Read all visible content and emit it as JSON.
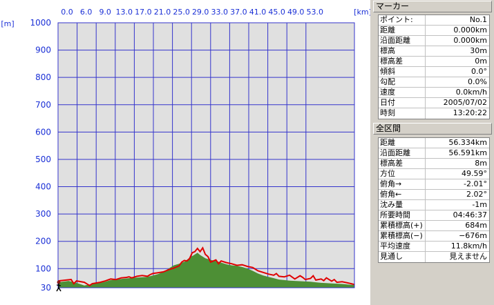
{
  "chart_data": {
    "type": "area",
    "x_unit": "[km]",
    "y_unit": "[m]",
    "x_tick_labels": [
      "0.0",
      "6.0",
      "9.0",
      "13.0",
      "17.0",
      "21.0",
      "25.0",
      "29.0",
      "33.0",
      "37.0",
      "41.0",
      "45.0",
      "49.0",
      "53.0"
    ],
    "y_tick_labels": [
      "1000",
      "900",
      "800",
      "700",
      "600",
      "500",
      "400",
      "300",
      "200",
      "100",
      "30"
    ],
    "xlim": [
      0,
      56.334
    ],
    "ylim": [
      30,
      1000
    ],
    "grid": true,
    "series": [
      {
        "x": [
          0,
          2,
          3.5,
          5,
          6,
          6.5,
          8,
          9,
          10,
          12,
          13,
          14,
          15.5,
          17,
          18,
          19,
          20,
          21,
          22,
          23,
          24,
          25,
          26,
          26.5,
          27,
          28,
          29,
          30,
          31,
          32,
          33,
          34,
          35,
          36,
          37,
          38,
          39,
          40,
          41,
          42,
          43,
          44,
          45,
          46,
          47,
          48,
          49,
          50,
          51,
          52,
          53,
          54,
          55,
          56.3
        ],
        "values": [
          50,
          55,
          48,
          38,
          42,
          45,
          48,
          52,
          58,
          62,
          64,
          66,
          68,
          70,
          75,
          80,
          88,
          100,
          112,
          118,
          125,
          140,
          152,
          158,
          150,
          138,
          132,
          128,
          122,
          116,
          112,
          110,
          106,
          100,
          92,
          82,
          75,
          70,
          65,
          60,
          58,
          56,
          55,
          54,
          53,
          52,
          50,
          48,
          47,
          46,
          45,
          44,
          42,
          40
        ]
      },
      {
        "x": [
          0,
          1.5,
          2.5,
          3,
          3.5,
          5,
          6,
          6.5,
          8,
          9,
          10,
          11,
          12,
          13,
          13.5,
          14,
          15,
          16,
          17,
          17.5,
          18,
          19,
          20,
          20.5,
          21,
          22,
          23,
          23.5,
          24,
          24.5,
          25,
          25.5,
          26,
          26.5,
          27,
          27.5,
          28,
          28.5,
          29,
          30,
          30.5,
          31,
          32,
          33,
          34,
          35,
          36,
          37,
          37.5,
          38,
          39,
          40,
          41,
          41.5,
          42,
          43,
          44,
          45,
          46,
          46.5,
          47,
          48,
          48.5,
          49,
          50,
          50.5,
          51,
          52,
          52.5,
          53,
          54,
          55,
          55.5,
          56.3
        ],
        "values": [
          55,
          58,
          60,
          45,
          55,
          50,
          38,
          45,
          50,
          55,
          62,
          60,
          66,
          68,
          70,
          66,
          72,
          75,
          72,
          78,
          82,
          85,
          88,
          92,
          96,
          102,
          110,
          124,
          130,
          128,
          137,
          158,
          162,
          174,
          162,
          176,
          152,
          144,
          124,
          132,
          118,
          128,
          122,
          118,
          112,
          114,
          108,
          104,
          98,
          92,
          86,
          80,
          76,
          82,
          72,
          70,
          76,
          62,
          74,
          68,
          60,
          64,
          74,
          58,
          62,
          56,
          66,
          54,
          60,
          50,
          52,
          48,
          46,
          42
        ]
      }
    ]
  },
  "marker": {
    "header": "マーカー",
    "rows": [
      {
        "label": "ポイント:",
        "value": "No.1"
      },
      {
        "label": "距離",
        "value": "0.000km"
      },
      {
        "label": "沿面距離",
        "value": "0.000km"
      },
      {
        "label": "標高",
        "value": "30m"
      },
      {
        "label": "標高差",
        "value": "0m"
      },
      {
        "label": "傾斜",
        "value": "0.0°"
      },
      {
        "label": "勾配",
        "value": "0.0%"
      },
      {
        "label": "速度",
        "value": "0.0km/h"
      },
      {
        "label": "日付",
        "value": "2005/07/02"
      },
      {
        "label": "時刻",
        "value": "13:20:22"
      }
    ]
  },
  "section": {
    "header": "全区間",
    "rows": [
      {
        "label": "距離",
        "value": "56.334km"
      },
      {
        "label": "沿面距離",
        "value": "56.591km"
      },
      {
        "label": "標高差",
        "value": "8m"
      },
      {
        "label": "方位",
        "value": "49.59°"
      },
      {
        "label": "俯角→",
        "value": "-2.01°"
      },
      {
        "label": "俯角←",
        "value": "2.02°"
      },
      {
        "label": "沈み量",
        "value": "-1m"
      },
      {
        "label": "所要時間",
        "value": "04:46:37"
      },
      {
        "label": "累積標高(+)",
        "value": "684m"
      },
      {
        "label": "累積標高(−)",
        "value": "−676m"
      },
      {
        "label": "平均速度",
        "value": "11.8km/h"
      },
      {
        "label": "見通し",
        "value": "見えません"
      }
    ]
  },
  "colors": {
    "plot_bg": "#e0e0e0",
    "grid": "#3333cc",
    "tick_text": "#1a2fd6",
    "terrain": "#4d8f35",
    "route": "#e00000"
  }
}
